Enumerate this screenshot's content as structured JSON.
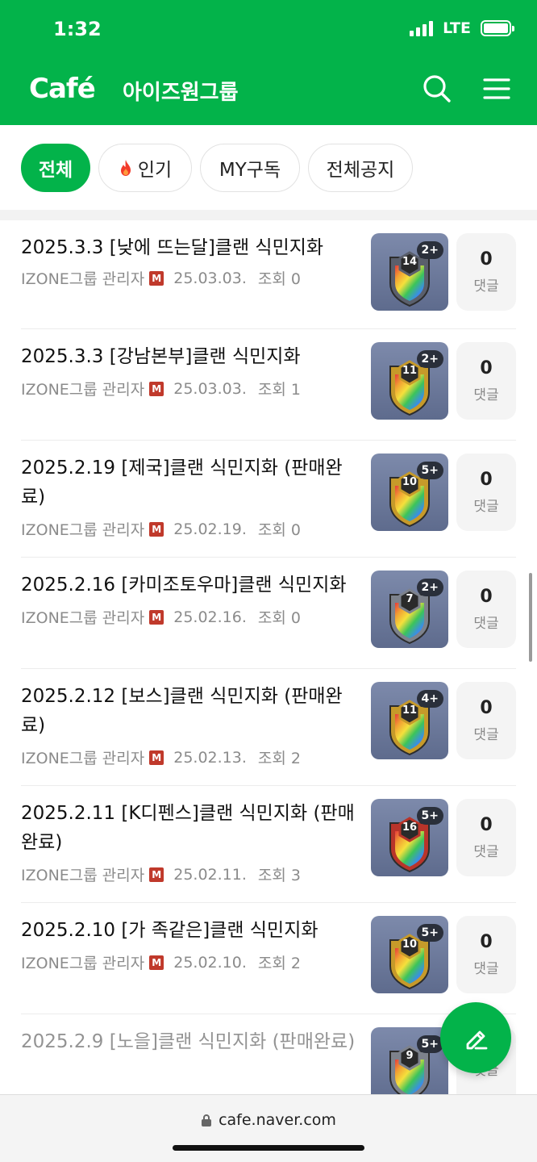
{
  "status": {
    "time": "1:32",
    "network": "LTE"
  },
  "header": {
    "logo": "Café",
    "cafe_name": "아이즈원그룹"
  },
  "tabs": [
    {
      "label": "전체",
      "active": true
    },
    {
      "label": "인기",
      "icon": "flame-icon"
    },
    {
      "label": "MY구독"
    },
    {
      "label": "전체공지"
    }
  ],
  "posts": [
    {
      "title": "2025.3.3 [낮에 뜨는달]클랜 식민지화",
      "author": "IZONE그룹 관리자",
      "badge": "M",
      "date": "25.03.03.",
      "views": "조회 0",
      "comments": "0",
      "comments_label": "댓글",
      "level": "14",
      "plus": "2+",
      "shield_color": "#5a5f6c"
    },
    {
      "title": "2025.3.3 [강남본부]클랜 식민지화",
      "author": "IZONE그룹 관리자",
      "badge": "M",
      "date": "25.03.03.",
      "views": "조회 1",
      "comments": "0",
      "comments_label": "댓글",
      "level": "11",
      "plus": "2+",
      "shield_color": "#c69a2a"
    },
    {
      "title": "2025.2.19 [제국]클랜 식민지화 (판매완료)",
      "author": "IZONE그룹 관리자",
      "badge": "M",
      "date": "25.02.19.",
      "views": "조회 0",
      "comments": "0",
      "comments_label": "댓글",
      "level": "10",
      "plus": "5+",
      "shield_color": "#c69a2a"
    },
    {
      "title": "2025.2.16 [카미조토우마]클랜 식민지화",
      "author": "IZONE그룹 관리자",
      "badge": "M",
      "date": "25.02.16.",
      "views": "조회 0",
      "comments": "0",
      "comments_label": "댓글",
      "level": "7",
      "plus": "2+",
      "shield_color": "#7d828c"
    },
    {
      "title": "2025.2.12 [보스]클랜 식민지화 (판매완료)",
      "author": "IZONE그룹 관리자",
      "badge": "M",
      "date": "25.02.13.",
      "views": "조회 2",
      "comments": "0",
      "comments_label": "댓글",
      "level": "11",
      "plus": "4+",
      "shield_color": "#c69a2a"
    },
    {
      "title": "2025.2.11 [K디펜스]클랜 식민지화 (판매완료)",
      "author": "IZONE그룹 관리자",
      "badge": "M",
      "date": "25.02.11.",
      "views": "조회 3",
      "comments": "0",
      "comments_label": "댓글",
      "level": "16",
      "plus": "5+",
      "shield_color": "#b8342a"
    },
    {
      "title": "2025.2.10 [가 족같은]클랜 식민지화",
      "author": "IZONE그룹 관리자",
      "badge": "M",
      "date": "25.02.10.",
      "views": "조회 2",
      "comments": "0",
      "comments_label": "댓글",
      "level": "10",
      "plus": "5+",
      "shield_color": "#c69a2a"
    },
    {
      "title": "2025.2.9 [노을]클랜 식민지화 (판매완료)",
      "author": "",
      "badge": "",
      "date": "",
      "views": "",
      "comments": "",
      "comments_label": "댓글",
      "level": "9",
      "plus": "5+",
      "shield_color": "#7d828c"
    }
  ],
  "browser": {
    "url": "cafe.naver.com"
  },
  "colors": {
    "brand": "#03b34a"
  }
}
